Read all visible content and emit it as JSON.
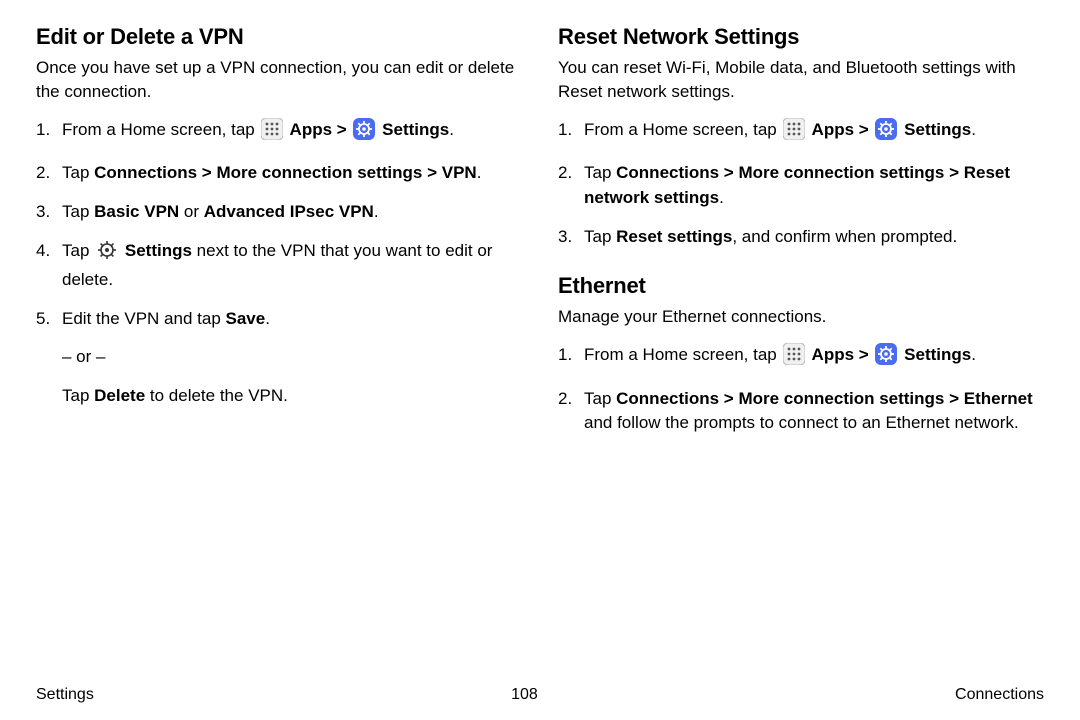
{
  "left": {
    "h": "Edit or Delete a VPN",
    "intro": "Once you have set up a VPN connection, you can edit or delete the connection.",
    "s1a": "From a Home screen, tap ",
    "s1apps": " Apps",
    "s1sep": " > ",
    "s1set": " Settings",
    "s1end": ".",
    "s2a": "Tap ",
    "s2b": "Connections > More connection settings > VPN",
    "s2c": ".",
    "s3a": "Tap ",
    "s3b": "Basic VPN",
    "s3c": " or ",
    "s3d": "Advanced IPsec VPN",
    "s3e": ".",
    "s4a": "Tap ",
    "s4b": " Settings",
    "s4c": " next to the VPN that you want to edit or delete.",
    "s5a": "Edit the VPN and tap ",
    "s5b": "Save",
    "s5c": ".",
    "or": "– or –",
    "s5d": "Tap ",
    "s5e": "Delete",
    "s5f": " to delete the VPN."
  },
  "right1": {
    "h": "Reset Network Settings",
    "intro": "You can reset Wi-Fi, Mobile data, and Bluetooth settings with Reset network settings.",
    "s1a": "From a Home screen, tap ",
    "s1apps": " Apps",
    "s1sep": " > ",
    "s1set": " Settings",
    "s1end": ".",
    "s2a": "Tap ",
    "s2b": "Connections > More connection settings > Reset network settings",
    "s2c": ".",
    "s3a": "Tap ",
    "s3b": "Reset settings",
    "s3c": ", and confirm when prompted."
  },
  "right2": {
    "h": "Ethernet",
    "intro": "Manage your Ethernet connections.",
    "s1a": "From a Home screen, tap ",
    "s1apps": " Apps",
    "s1sep": " > ",
    "s1set": " Settings",
    "s1end": ".",
    "s2a": "Tap ",
    "s2b": "Connections > More connection settings > Ethernet",
    "s2c": " and follow the prompts to connect to an Ethernet network."
  },
  "footer": {
    "left": "Settings",
    "center": "108",
    "right": "Connections"
  }
}
